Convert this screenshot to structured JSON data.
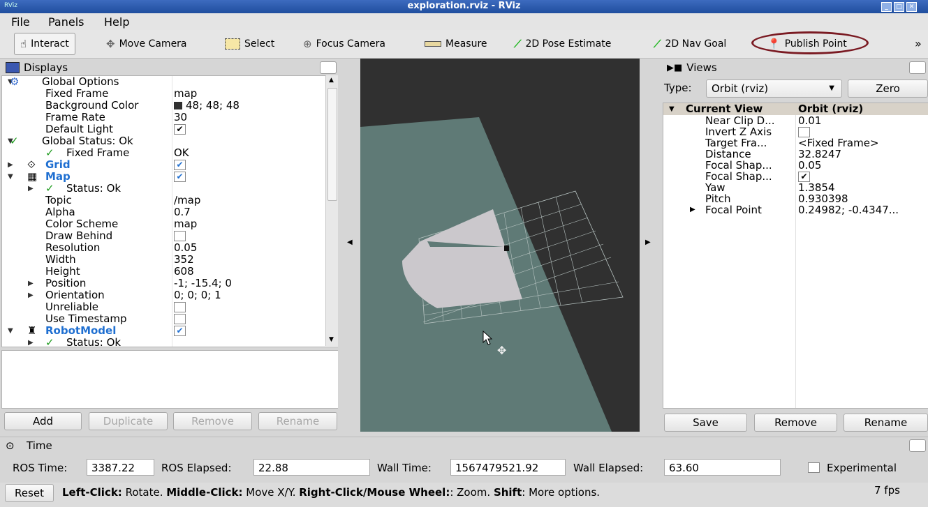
{
  "window": {
    "app_name": "RViz",
    "title": "exploration.rviz - RViz"
  },
  "menu": [
    "File",
    "Panels",
    "Help"
  ],
  "toolbar": {
    "tools": [
      {
        "name": "interact",
        "label": "Interact",
        "icon": "hand-icon"
      },
      {
        "name": "move-camera",
        "label": "Move Camera",
        "icon": "move-camera-icon"
      },
      {
        "name": "select",
        "label": "Select",
        "icon": "select-icon"
      },
      {
        "name": "focus-camera",
        "label": "Focus Camera",
        "icon": "focus-camera-icon"
      },
      {
        "name": "measure",
        "label": "Measure",
        "icon": "ruler-icon"
      },
      {
        "name": "2d-pose-estimate",
        "label": "2D Pose Estimate",
        "icon": "green-arrow-icon"
      },
      {
        "name": "2d-nav-goal",
        "label": "2D Nav Goal",
        "icon": "green-arrow-icon"
      },
      {
        "name": "publish-point",
        "label": "Publish Point",
        "icon": "map-pin-icon"
      }
    ],
    "overflow": "»",
    "highlight_color": "#7a1a22"
  },
  "displays": {
    "title": "Displays",
    "rows": [
      {
        "label": "Global Options",
        "value": "",
        "arrow": "▼"
      },
      {
        "label": "Fixed Frame",
        "value": "map"
      },
      {
        "label": "Background Color",
        "value": "48; 48; 48"
      },
      {
        "label": "Frame Rate",
        "value": "30"
      },
      {
        "label": "Default Light",
        "value": "✔"
      },
      {
        "label": "Global Status: Ok",
        "value": "",
        "arrow": "▼"
      },
      {
        "label": "Fixed Frame",
        "value": "OK"
      },
      {
        "label": "Grid",
        "value": "✔",
        "arrow": "▶"
      },
      {
        "label": "Map",
        "value": "✔",
        "arrow": "▼"
      },
      {
        "label": "Status: Ok",
        "value": "",
        "arrow": "▶"
      },
      {
        "label": "Topic",
        "value": "/map"
      },
      {
        "label": "Alpha",
        "value": "0.7"
      },
      {
        "label": "Color Scheme",
        "value": "map"
      },
      {
        "label": "Draw Behind",
        "value": ""
      },
      {
        "label": "Resolution",
        "value": "0.05"
      },
      {
        "label": "Width",
        "value": "352"
      },
      {
        "label": "Height",
        "value": "608"
      },
      {
        "label": "Position",
        "value": "-1; -15.4; 0",
        "arrow": "▶"
      },
      {
        "label": "Orientation",
        "value": "0; 0; 0; 1",
        "arrow": "▶"
      },
      {
        "label": "Unreliable",
        "value": ""
      },
      {
        "label": "Use Timestamp",
        "value": ""
      },
      {
        "label": "RobotModel",
        "value": "✔",
        "arrow": "▼"
      },
      {
        "label": "Status: Ok",
        "value": "",
        "arrow": "▶"
      }
    ],
    "buttons": {
      "add": "Add",
      "duplicate": "Duplicate",
      "remove": "Remove",
      "rename": "Rename"
    }
  },
  "views": {
    "title": "Views",
    "type_label": "Type:",
    "type_value": "Orbit (rviz)",
    "zero": "Zero",
    "header": {
      "label": "Current View",
      "value": "Orbit (rviz)"
    },
    "rows": [
      {
        "label": "Near Clip D...",
        "value": "0.01"
      },
      {
        "label": "Invert Z Axis",
        "value": ""
      },
      {
        "label": "Target Fra...",
        "value": "<Fixed Frame>"
      },
      {
        "label": "Distance",
        "value": "32.8247"
      },
      {
        "label": "Focal Shap...",
        "value": "0.05"
      },
      {
        "label": "Focal Shap...",
        "value": "✔"
      },
      {
        "label": "Yaw",
        "value": "1.3854"
      },
      {
        "label": "Pitch",
        "value": "0.930398"
      },
      {
        "label": "Focal Point",
        "value": "0.24982; -0.4347..."
      }
    ],
    "buttons": {
      "save": "Save",
      "remove": "Remove",
      "rename": "Rename"
    }
  },
  "time": {
    "title": "Time",
    "ros_time_label": "ROS Time:",
    "ros_time": "3387.22",
    "ros_elapsed_label": "ROS Elapsed:",
    "ros_elapsed": "22.88",
    "wall_time_label": "Wall Time:",
    "wall_time": "1567479521.92",
    "wall_elapsed_label": "Wall Elapsed:",
    "wall_elapsed": "63.60",
    "experimental": "Experimental"
  },
  "status": {
    "reset": "Reset",
    "lc": "Left-Click:",
    "lc_t": " Rotate. ",
    "mc": "Middle-Click:",
    "mc_t": " Move X/Y. ",
    "rc": "Right-Click/Mouse Wheel:",
    "rc_t": ": Zoom. ",
    "sh": "Shift",
    "sh_t": ": More options.",
    "fps": "7 fps"
  },
  "colors": {
    "viewport_bg": "#303030",
    "floor": "#5f7a76",
    "map": "#c8c4c8",
    "accent_blue": "#1f6fd1"
  }
}
